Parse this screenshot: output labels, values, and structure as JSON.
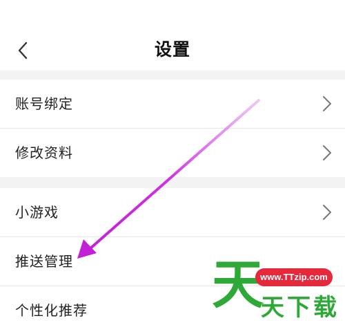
{
  "header": {
    "title": "设置",
    "back_icon": "chevron-left-icon"
  },
  "groups": [
    {
      "items": [
        {
          "label": "账号绑定"
        },
        {
          "label": "修改资料"
        }
      ]
    },
    {
      "items": [
        {
          "label": "小游戏"
        },
        {
          "label": "推送管理"
        },
        {
          "label": "个性化推荐"
        }
      ]
    }
  ],
  "annotation": {
    "arrow_color": "#cc33dd"
  },
  "watermark": {
    "url": "www.TTzip.com",
    "big_char": "天",
    "text": "天下载",
    "color": "#2ea836",
    "badge_color": "#e5283a"
  }
}
